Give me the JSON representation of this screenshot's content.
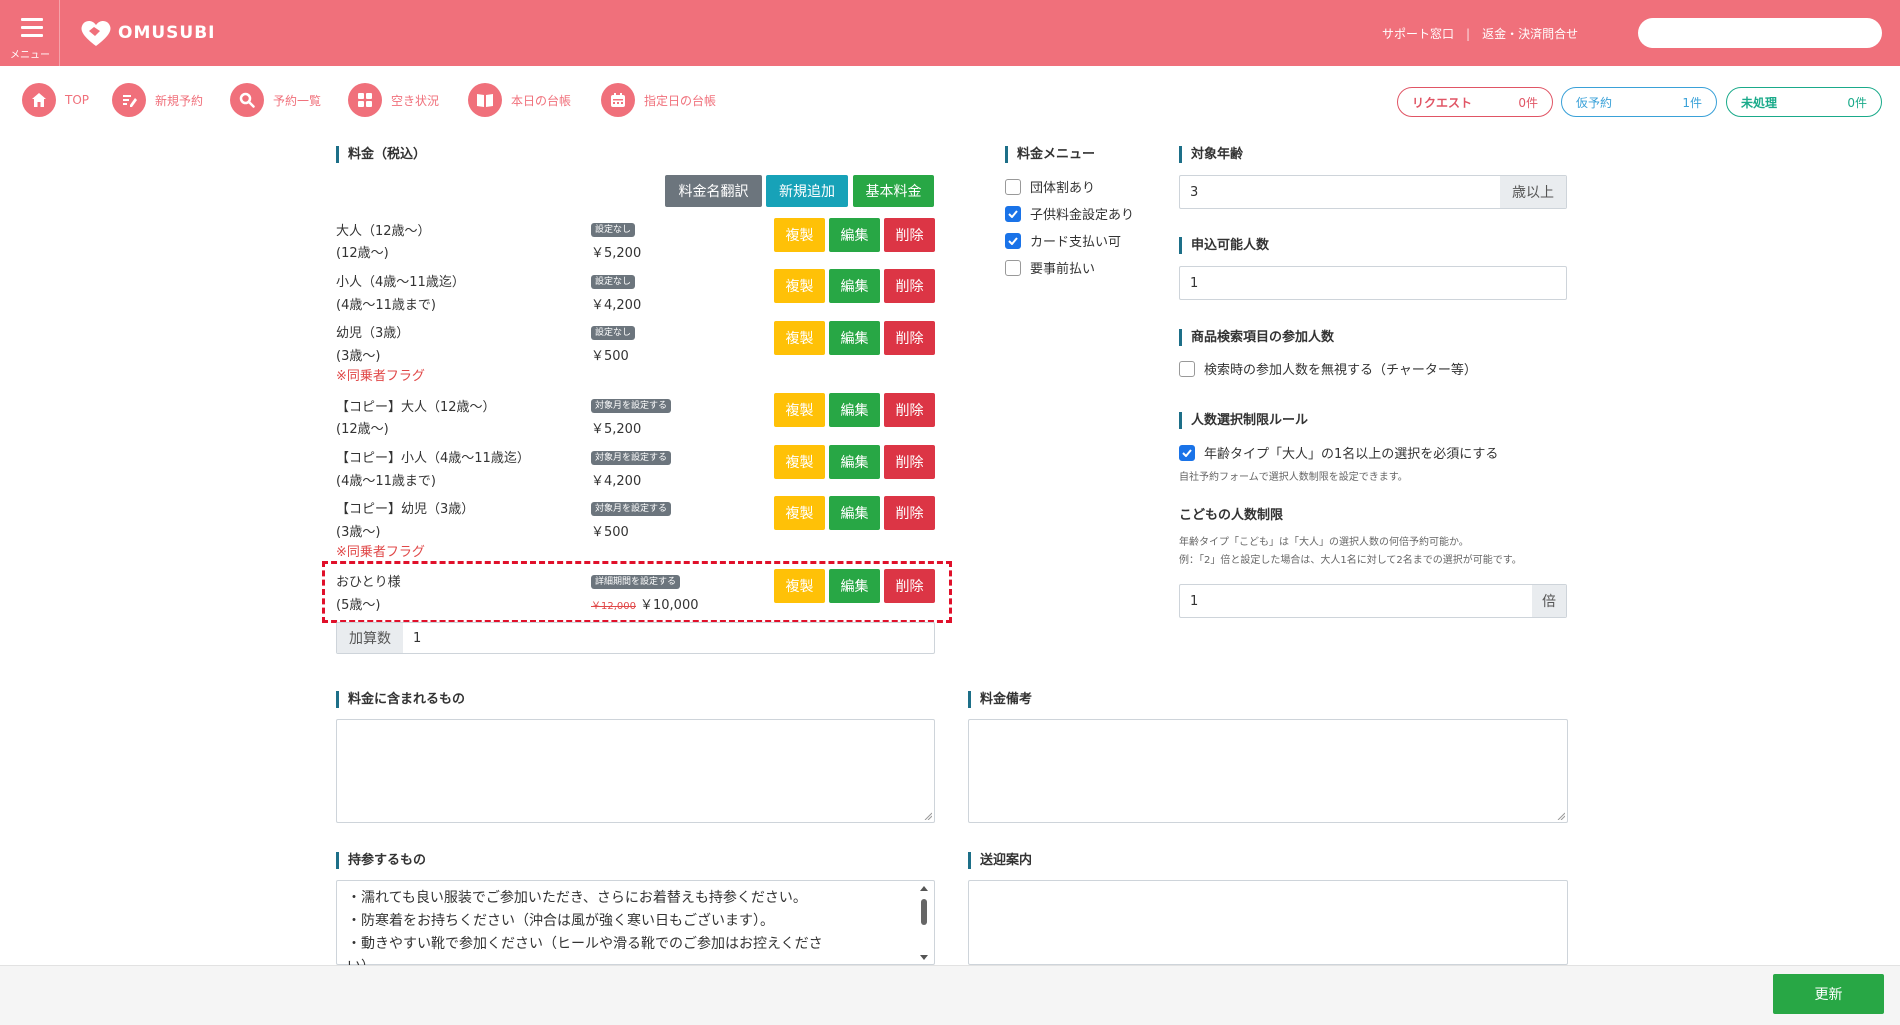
{
  "header": {
    "menu_label": "メニュー",
    "logo_text": "OMUSUBI",
    "links": [
      "サポート窓口",
      "返金・決済問合せ"
    ],
    "link_separator": "|",
    "search_placeholder": "",
    "color": "#f0707b"
  },
  "nav": {
    "items": [
      {
        "label": "TOP",
        "icon": "home-icon"
      },
      {
        "label": "新規予約",
        "icon": "edit-icon"
      },
      {
        "label": "予約一覧",
        "icon": "search-icon"
      },
      {
        "label": "空き状況",
        "icon": "grid-icon"
      },
      {
        "label": "本日の台帳",
        "icon": "book-icon"
      },
      {
        "label": "指定日の台帳",
        "icon": "calendar-icon"
      }
    ],
    "status": [
      {
        "label": "リクエスト",
        "value": "0件",
        "color": "#e05565"
      },
      {
        "label": "仮予約",
        "value": "1件",
        "color": "#3aa1d8"
      },
      {
        "label": "未処理",
        "value": "0件",
        "color": "#1aaa8a"
      }
    ]
  },
  "price_section": {
    "title": "料金（税込）",
    "top_buttons": {
      "translate": "料金名翻訳",
      "add": "新規追加",
      "base": "基本料金"
    },
    "row_buttons": {
      "copy": "複製",
      "edit": "編集",
      "delete": "削除"
    },
    "rows": [
      {
        "name": "大人（12歳〜）",
        "sub": "(12歳〜)",
        "badge": "設定なし",
        "price": "￥5,200"
      },
      {
        "name": "小人（4歳〜11歳迄）",
        "sub": "(4歳〜11歳まで)",
        "badge": "設定なし",
        "price": "￥4,200"
      },
      {
        "name": "幼児（3歳）",
        "sub": "(3歳〜)",
        "badge": "設定なし",
        "price": "￥500",
        "flag": "※同乗者フラグ"
      },
      {
        "name": "【コピー】大人（12歳〜）",
        "sub": "(12歳〜)",
        "badge": "対象月を設定する",
        "price": "￥5,200"
      },
      {
        "name": "【コピー】小人（4歳〜11歳迄）",
        "sub": "(4歳〜11歳まで)",
        "badge": "対象月を設定する",
        "price": "￥4,200"
      },
      {
        "name": "【コピー】幼児（3歳）",
        "sub": "(3歳〜)",
        "badge": "対象月を設定する",
        "price": "￥500",
        "flag": "※同乗者フラグ"
      },
      {
        "name": "おひとり様",
        "sub": "(5歳〜)",
        "badge": "詳細期間を設定する",
        "old_price": "￥12,000",
        "price": "￥10,000"
      }
    ],
    "addition": {
      "label": "加算数",
      "value": "1"
    }
  },
  "price_menu": {
    "title": "料金メニュー",
    "options": [
      {
        "label": "団体割あり",
        "checked": false
      },
      {
        "label": "子供料金設定あり",
        "checked": true
      },
      {
        "label": "カード支払い可",
        "checked": true
      },
      {
        "label": "要事前払い",
        "checked": false
      }
    ]
  },
  "target_age": {
    "title": "対象年齢",
    "value": "3",
    "suffix": "歳以上"
  },
  "applicants": {
    "title": "申込可能人数",
    "value": "1"
  },
  "search_people": {
    "title": "商品検索項目の参加人数",
    "option": "検索時の参加人数を無視する（チャーター等）",
    "checked": false
  },
  "selection_rule": {
    "title": "人数選択制限ルール",
    "option": "年齢タイプ「大人」の1名以上の選択を必須にする",
    "checked": true,
    "help": "自社予約フォームで選択人数制限を設定できます。"
  },
  "child_limit": {
    "title": "こどもの人数制限",
    "help1": "年齢タイプ「こども」は「大人」の選択人数の何倍予約可能か。",
    "help2": "例：「2」倍と設定した場合は、大人1名に対して2名までの選択が可能です。",
    "value": "1",
    "suffix": "倍"
  },
  "included": {
    "title": "料金に含まれるもの",
    "value": ""
  },
  "notes": {
    "title": "料金備考",
    "value": ""
  },
  "bring": {
    "title": "持参するもの",
    "lines": [
      "・濡れても良い服装でご参加いただき、さらにお着替えも持参ください。",
      "・防寒着をお持ちください（沖合は風が強く寒い日もございます）。",
      "・動きやすい靴で参加ください（ヒールや滑る靴でのご参加はお控えくださ",
      "い）"
    ]
  },
  "transfer": {
    "title": "送迎案内",
    "value": ""
  },
  "footer": {
    "update": "更新"
  }
}
